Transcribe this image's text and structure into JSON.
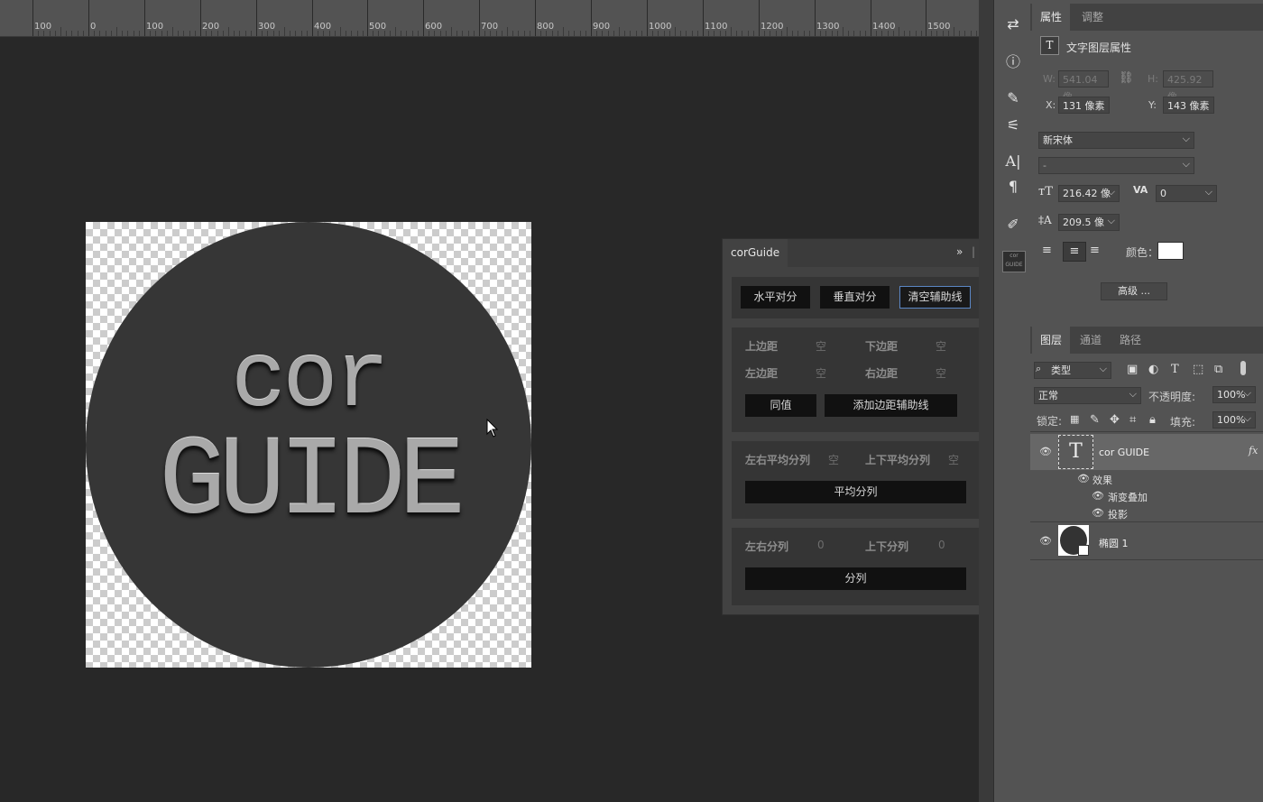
{
  "ruler": {
    "labels": [
      "100",
      "0",
      "100",
      "200",
      "300",
      "400",
      "500",
      "600",
      "700",
      "800",
      "900",
      "1000",
      "1100",
      "1200",
      "1300",
      "1400",
      "1500"
    ]
  },
  "canvas": {
    "text_line1": "cor",
    "text_line2": "GUIDE"
  },
  "properties_panel": {
    "tabs": [
      "属性",
      "调整"
    ],
    "header": "文字图层属性",
    "w_label": "W:",
    "w_value": "541.04 像",
    "h_label": "H:",
    "h_value": "425.92 像",
    "x_label": "X:",
    "x_value": "131 像素",
    "y_label": "Y:",
    "y_value": "143 像素",
    "font_family": "新宋体",
    "font_style": "-",
    "font_size": "216.42 像",
    "tracking": "0",
    "leading": "209.5 像",
    "color_label": "颜色：",
    "text_color": "#ffffff",
    "advanced_button": "高级 ..."
  },
  "layers_panel": {
    "tabs": [
      "图层",
      "通道",
      "路径"
    ],
    "filter_kind": "类型",
    "blend_mode": "正常",
    "opacity_label": "不透明度:",
    "opacity_value": "100%",
    "lock_label": "锁定:",
    "fill_label": "填充:",
    "fill_value": "100%",
    "layers": [
      {
        "name": "cor GUIDE",
        "fx": "fx",
        "effects_label": "效果",
        "effects": [
          "渐变叠加",
          "投影"
        ]
      },
      {
        "name": "椭圆 1"
      }
    ]
  },
  "corguide_panel": {
    "tab": "corGuide",
    "buttons_top": [
      "水平对分",
      "垂直对分",
      "清空辅助线"
    ],
    "margin_labels": {
      "top": "上边距",
      "bottom": "下边距",
      "left": "左边距",
      "right": "右边距"
    },
    "empty_value": "空",
    "same_value_button": "同值",
    "add_margin_button": "添加边距辅助线",
    "avg_h_label": "左右平均分列",
    "avg_v_label": "上下平均分列",
    "avg_button": "平均分列",
    "split_h_label": "左右分列",
    "split_v_label": "上下分列",
    "split_h_value": "0",
    "split_v_value": "0",
    "split_button": "分列"
  },
  "colors": {
    "accent_outline": "#5b86c4",
    "canvas_bg": "#282828",
    "panel_bg": "#535353"
  }
}
